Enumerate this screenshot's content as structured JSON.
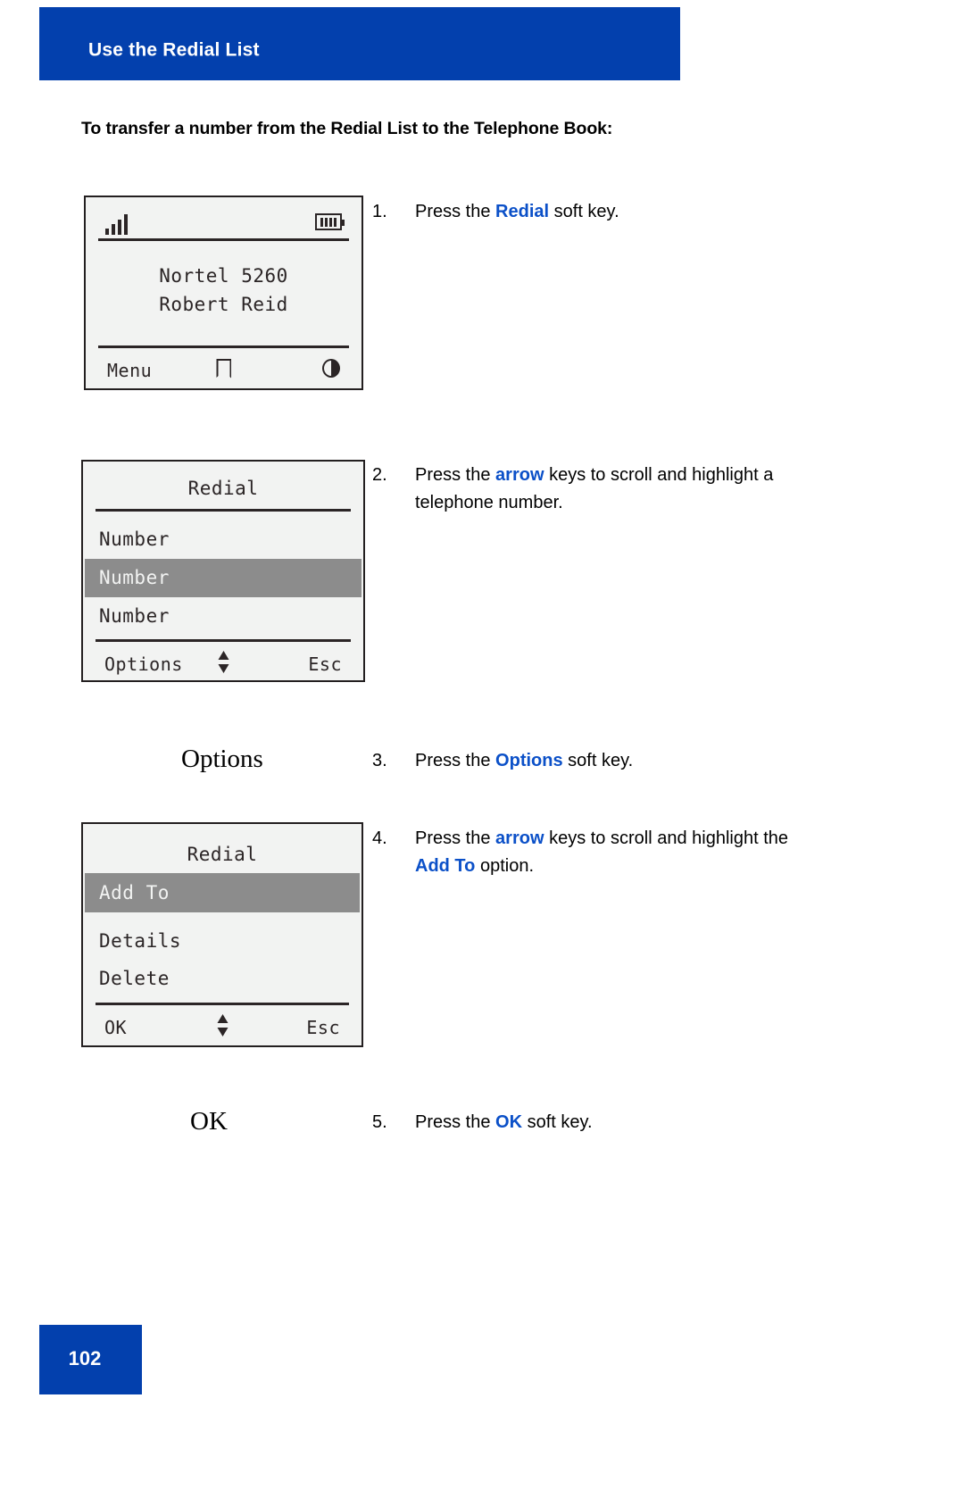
{
  "header": {
    "title": "Use the Redial List"
  },
  "intro_heading": "To transfer a number from the Redial List to the Telephone Book:",
  "screens": {
    "idle": {
      "signal_icon": "signal-bars-icon",
      "battery_icon": "battery-icon",
      "line1": "Nortel 5260",
      "line2": "Robert Reid",
      "softkey_left": "Menu",
      "softkey_mid_icon": "phonebook-icon",
      "softkey_right_icon": "contrast-icon"
    },
    "redial_list": {
      "title": "Redial",
      "items": [
        {
          "label": "Number",
          "highlighted": false
        },
        {
          "label": "Number",
          "highlighted": true
        },
        {
          "label": "Number",
          "highlighted": false
        }
      ],
      "softkey_left": "Options",
      "softkey_mid_icon": "up-down-arrow-icon",
      "softkey_right": "Esc"
    },
    "redial_options": {
      "title": "Redial",
      "items": [
        {
          "label": "Add To",
          "highlighted": true
        },
        {
          "label": "Details",
          "highlighted": false
        },
        {
          "label": "Delete",
          "highlighted": false
        }
      ],
      "softkey_left": "OK",
      "softkey_mid_icon": "up-down-arrow-icon",
      "softkey_right": "Esc"
    }
  },
  "softkey_captions": {
    "options": "Options",
    "ok": "OK"
  },
  "steps": [
    {
      "num": "1.",
      "pre": "Press the ",
      "key": "Redial",
      "post": " soft key."
    },
    {
      "num": "2.",
      "pre": "Press the ",
      "key": "arrow",
      "post": " keys to scroll and highlight a telephone number."
    },
    {
      "num": "3.",
      "pre": "Press the ",
      "key": "Options",
      "post": " soft key."
    },
    {
      "num": "4.",
      "pre": "Press the ",
      "key": "arrow",
      "post": " keys to scroll and highlight the ",
      "key2": "Add To",
      "post2": " option."
    },
    {
      "num": "5.",
      "pre": "Press the ",
      "key": "OK",
      "post": " soft key."
    }
  ],
  "footer": {
    "page_number": "102"
  },
  "colors": {
    "brand_blue": "#0340ad",
    "link_blue": "#0b50c8",
    "lcd_background": "#f2f3f2",
    "lcd_ink": "#2b2526",
    "highlight_gray": "#8c8c8c"
  }
}
